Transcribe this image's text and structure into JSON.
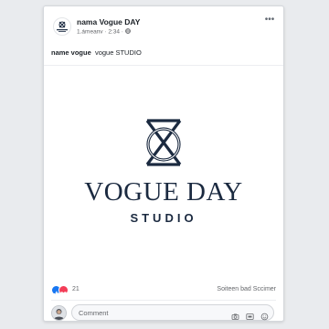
{
  "post": {
    "page_name": "nama Vogue DAY",
    "meta": "1.ámeanv · 2:34 · ",
    "caption_bold": "name vogue",
    "caption_text": "vogue STUDIO"
  },
  "image": {
    "brand_title": "VOGUE DAY",
    "brand_subtitle": "STUDIO",
    "brand_color": "#1b2a40"
  },
  "logo_mini": {
    "line1": "VOGUE DAY",
    "line2": "STUDIO"
  },
  "reactions": {
    "count": "21",
    "shares_text": "Soiteen bad Sccimer",
    "like_color": "#1877f2",
    "love_color": "#f33e58"
  },
  "comment": {
    "placeholder": "Comment"
  },
  "icons": {
    "more": "more-options-icon",
    "camera": "camera-icon",
    "gif": "gif-icon",
    "sticker": "sticker-icon"
  }
}
